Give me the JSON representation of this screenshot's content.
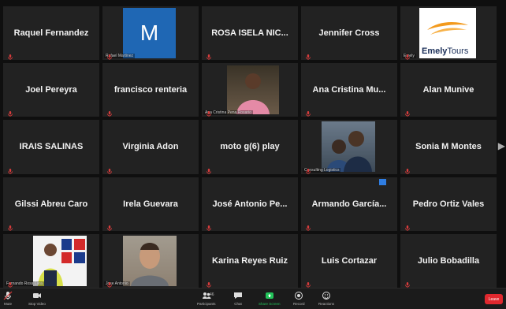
{
  "participants": [
    {
      "name": "Raquel Fernandez"
    },
    {
      "name": "",
      "caption": "Rafael Martinez",
      "initial": "M",
      "avatar_color": "#1f67b4"
    },
    {
      "name": "ROSA ISELA NIC..."
    },
    {
      "name": "Jennifer Cross"
    },
    {
      "name": "",
      "caption": "Emely",
      "logo": "Emely",
      "logo2": "Tours"
    },
    {
      "name": "Joel Pereyra"
    },
    {
      "name": "francisco renteria"
    },
    {
      "name": "",
      "caption": "Ana Cristina Pena Rosario"
    },
    {
      "name": "Ana Cristina Mu..."
    },
    {
      "name": "Alan Munive"
    },
    {
      "name": "IRAIS SALINAS"
    },
    {
      "name": "Virginia Adon"
    },
    {
      "name": "moto g(6) play"
    },
    {
      "name": "",
      "caption": "Consulting Logistics"
    },
    {
      "name": "Sonia M Montes"
    },
    {
      "name": "Gilssi Abreu Caro"
    },
    {
      "name": "Irela Guevara"
    },
    {
      "name": "José Antonio Pe..."
    },
    {
      "name": "Armando  García..."
    },
    {
      "name": "Pedro Ortiz Vales"
    },
    {
      "name": "",
      "caption": "Fernando Rosa Lara"
    },
    {
      "name": "",
      "caption": "Jose Antonio"
    },
    {
      "name": "Karina Reyes Ruiz"
    },
    {
      "name": "Luis Cortazar"
    },
    {
      "name": "Julio Bobadilla"
    }
  ],
  "toolbar": {
    "mute": "Mute",
    "video": "Stop Video",
    "participants": "Participants",
    "participants_count": "46",
    "chat": "Chat",
    "share": "Share Screen",
    "record": "Record",
    "reactions": "Reactions",
    "end": "Leave"
  },
  "colors": {
    "mic_muted": "#d93c3c",
    "share": "#23c35a",
    "end": "#e0282e"
  }
}
